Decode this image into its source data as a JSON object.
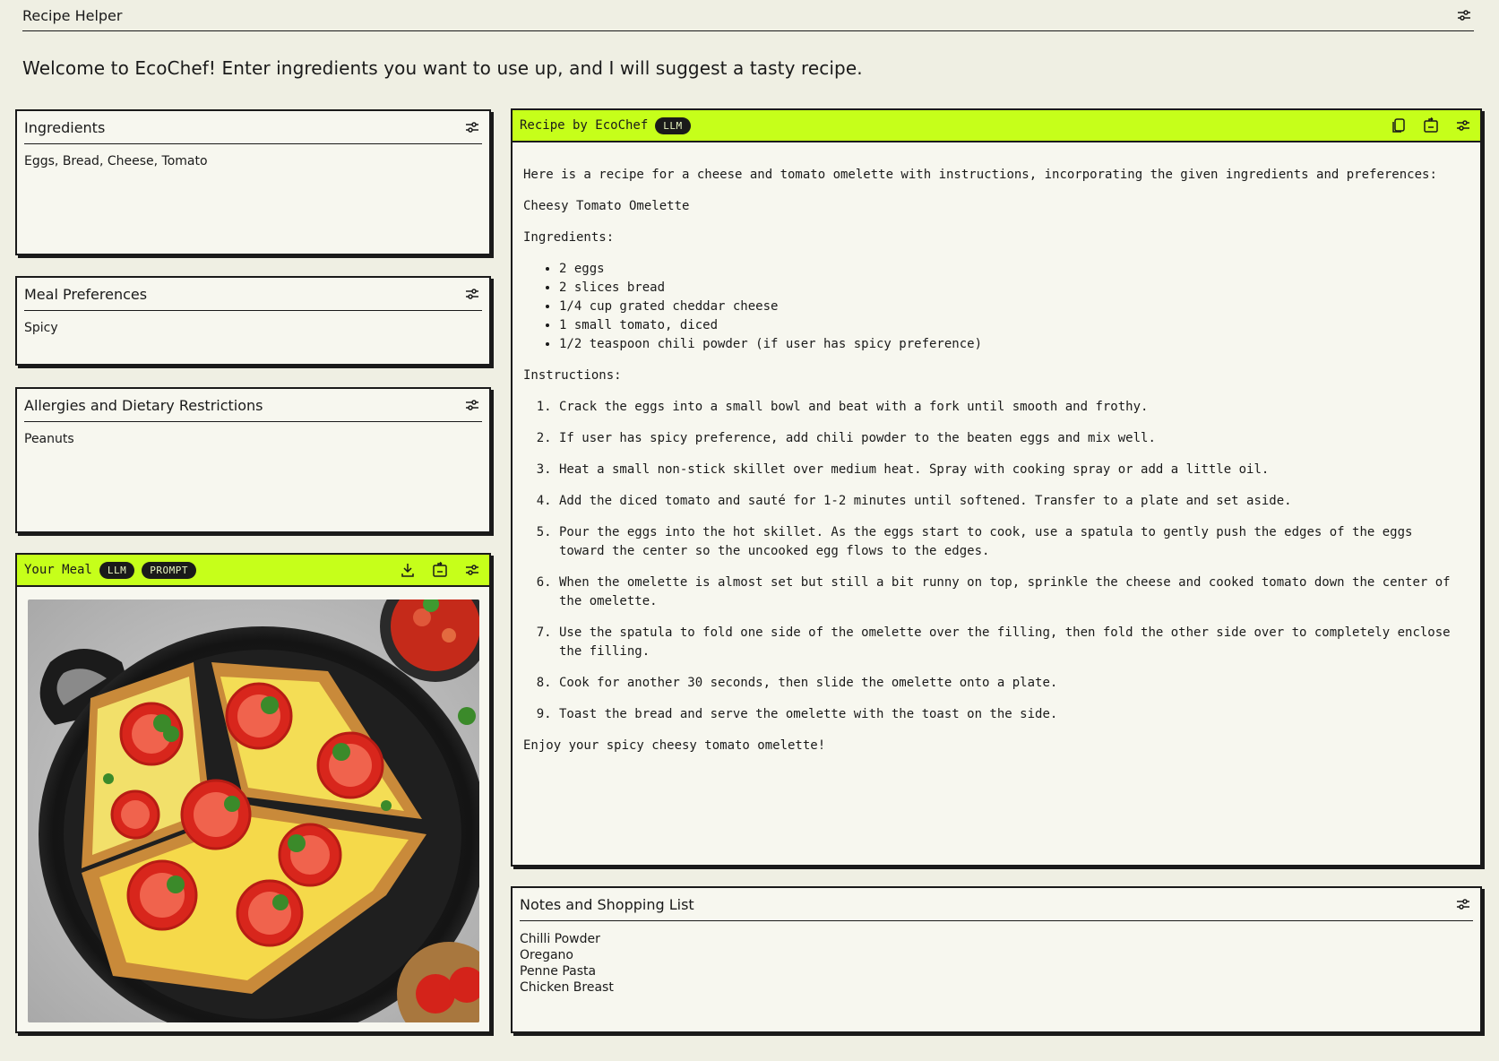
{
  "app": {
    "title": "Recipe Helper"
  },
  "welcome": "Welcome to EcoChef! Enter ingredients you want to use up, and I will suggest a tasty recipe.",
  "ingredients_panel": {
    "title": "Ingredients",
    "value": "Eggs, Bread, Cheese, Tomato"
  },
  "meal_prefs_panel": {
    "title": "Meal Preferences",
    "value": "Spicy"
  },
  "allergies_panel": {
    "title": "Allergies and Dietary Restrictions",
    "value": "Peanuts"
  },
  "meal_panel": {
    "title": "Your Meal",
    "badges": [
      "LLM",
      "PROMPT"
    ]
  },
  "recipe_panel": {
    "title": "Recipe by EcoChef",
    "badge": "LLM",
    "intro": "Here is a recipe for a cheese and tomato omelette with instructions, incorporating the given ingredients and preferences:",
    "dish_name": "Cheesy Tomato Omelette",
    "ingredients_heading": "Ingredients:",
    "ingredients": [
      "2 eggs",
      "2 slices bread",
      "1/4 cup grated cheddar cheese",
      "1 small tomato, diced",
      "1/2 teaspoon chili powder (if user has spicy preference)"
    ],
    "instructions_heading": "Instructions:",
    "instructions": [
      "Crack the eggs into a small bowl and beat with a fork until smooth and frothy.",
      "If user has spicy preference, add chili powder to the beaten eggs and mix well.",
      "Heat a small non-stick skillet over medium heat. Spray with cooking spray or add a little oil.",
      "Add the diced tomato and sauté for 1-2 minutes until softened. Transfer to a plate and set aside.",
      "Pour the eggs into the hot skillet. As the eggs start to cook, use a spatula to gently push the edges of the eggs toward the center so the uncooked egg flows to the edges.",
      "When the omelette is almost set but still a bit runny on top, sprinkle the cheese and cooked tomato down the center of the omelette.",
      "Use the spatula to fold one side of the omelette over the filling, then fold the other side over to completely enclose the filling.",
      "Cook for another 30 seconds, then slide the omelette onto a plate.",
      "Toast the bread and serve the omelette with the toast on the side."
    ],
    "outro": "Enjoy your spicy cheesy tomato omelette!"
  },
  "notes_panel": {
    "title": "Notes and Shopping List",
    "items": [
      "Chilli Powder",
      "Oregano",
      "Penne Pasta",
      "Chicken Breast"
    ]
  },
  "colors": {
    "accent": "#c6ff1a",
    "background": "#efefe3",
    "panel": "#f7f7ef",
    "ink": "#1a1a1a"
  },
  "icons": [
    "settings-sliders-icon",
    "copy-icon",
    "share-icon",
    "download-icon"
  ]
}
